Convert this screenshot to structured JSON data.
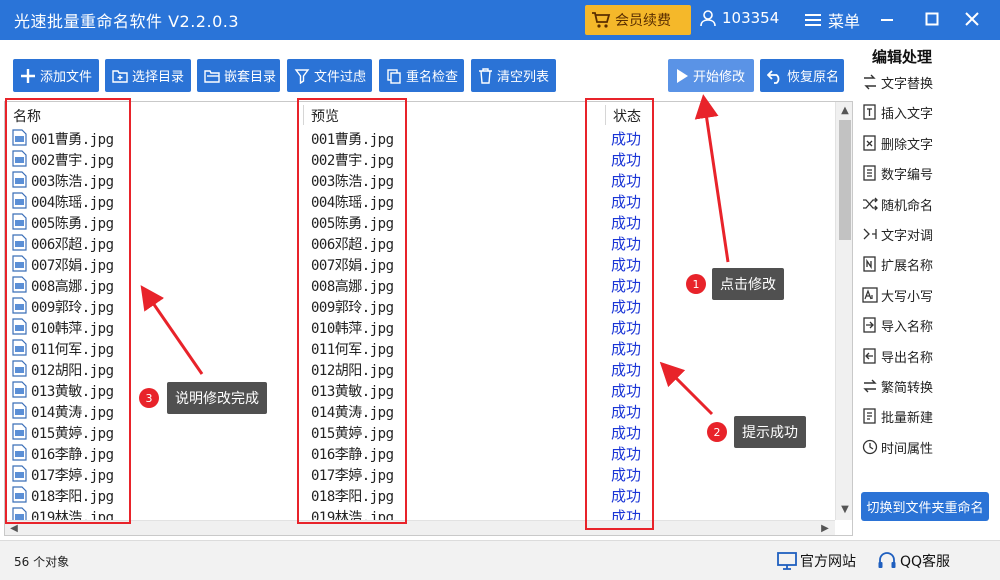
{
  "app": {
    "title": "光速批量重命名软件 V2.2.0.3",
    "vip_label": "会员续费",
    "user_id": "103354",
    "menu_label": "菜单"
  },
  "toolbar": {
    "add_file": "添加文件",
    "select_dir": "选择目录",
    "nested_dir": "嵌套目录",
    "file_filter": "文件过虑",
    "dup_check": "重名检查",
    "clear_list": "清空列表",
    "start_modify": "开始修改",
    "restore_name": "恢复原名"
  },
  "table": {
    "headers": {
      "name": "名称",
      "preview": "预览",
      "status": "状态"
    },
    "rows": [
      {
        "name": "001曹勇.jpg",
        "preview": "001曹勇.jpg",
        "status": "成功"
      },
      {
        "name": "002曹宇.jpg",
        "preview": "002曹宇.jpg",
        "status": "成功"
      },
      {
        "name": "003陈浩.jpg",
        "preview": "003陈浩.jpg",
        "status": "成功"
      },
      {
        "name": "004陈瑶.jpg",
        "preview": "004陈瑶.jpg",
        "status": "成功"
      },
      {
        "name": "005陈勇.jpg",
        "preview": "005陈勇.jpg",
        "status": "成功"
      },
      {
        "name": "006邓超.jpg",
        "preview": "006邓超.jpg",
        "status": "成功"
      },
      {
        "name": "007邓娟.jpg",
        "preview": "007邓娟.jpg",
        "status": "成功"
      },
      {
        "name": "008高娜.jpg",
        "preview": "008高娜.jpg",
        "status": "成功"
      },
      {
        "name": "009郭玲.jpg",
        "preview": "009郭玲.jpg",
        "status": "成功"
      },
      {
        "name": "010韩萍.jpg",
        "preview": "010韩萍.jpg",
        "status": "成功"
      },
      {
        "name": "011何军.jpg",
        "preview": "011何军.jpg",
        "status": "成功"
      },
      {
        "name": "012胡阳.jpg",
        "preview": "012胡阳.jpg",
        "status": "成功"
      },
      {
        "name": "013黄敏.jpg",
        "preview": "013黄敏.jpg",
        "status": "成功"
      },
      {
        "name": "014黄涛.jpg",
        "preview": "014黄涛.jpg",
        "status": "成功"
      },
      {
        "name": "015黄婷.jpg",
        "preview": "015黄婷.jpg",
        "status": "成功"
      },
      {
        "name": "016李静.jpg",
        "preview": "016李静.jpg",
        "status": "成功"
      },
      {
        "name": "017李婷.jpg",
        "preview": "017李婷.jpg",
        "status": "成功"
      },
      {
        "name": "018李阳.jpg",
        "preview": "018李阳.jpg",
        "status": "成功"
      },
      {
        "name": "019林浩.jpg",
        "preview": "019林浩.jpg",
        "status": "成功"
      }
    ]
  },
  "sidebar": {
    "title": "编辑处理",
    "items": [
      {
        "label": "文字替换",
        "icon": "swap-icon"
      },
      {
        "label": "插入文字",
        "icon": "insert-text-icon"
      },
      {
        "label": "删除文字",
        "icon": "delete-text-icon"
      },
      {
        "label": "数字编号",
        "icon": "number-icon"
      },
      {
        "label": "随机命名",
        "icon": "shuffle-icon"
      },
      {
        "label": "文字对调",
        "icon": "exchange-icon"
      },
      {
        "label": "扩展名称",
        "icon": "extension-icon"
      },
      {
        "label": "大写小写",
        "icon": "case-icon"
      },
      {
        "label": "导入名称",
        "icon": "import-icon"
      },
      {
        "label": "导出名称",
        "icon": "export-icon"
      },
      {
        "label": "繁简转换",
        "icon": "convert-icon"
      },
      {
        "label": "批量新建",
        "icon": "batch-new-icon"
      },
      {
        "label": "时间属性",
        "icon": "clock-icon"
      }
    ],
    "switch_label": "切换到文件夹重命名"
  },
  "statusbar": {
    "object_count": "56 个对象",
    "website": "官方网站",
    "qq_service": "QQ客服"
  },
  "annotations": [
    {
      "number": "1",
      "text": "点击修改"
    },
    {
      "number": "2",
      "text": "提示成功"
    },
    {
      "number": "3",
      "text": "说明修改完成"
    }
  ],
  "colors": {
    "titlebar": "#2a74d8",
    "button": "#2b73d6",
    "vip": "#f5b82a",
    "status_text": "#1a35d6",
    "highlight": "#e8232a"
  }
}
